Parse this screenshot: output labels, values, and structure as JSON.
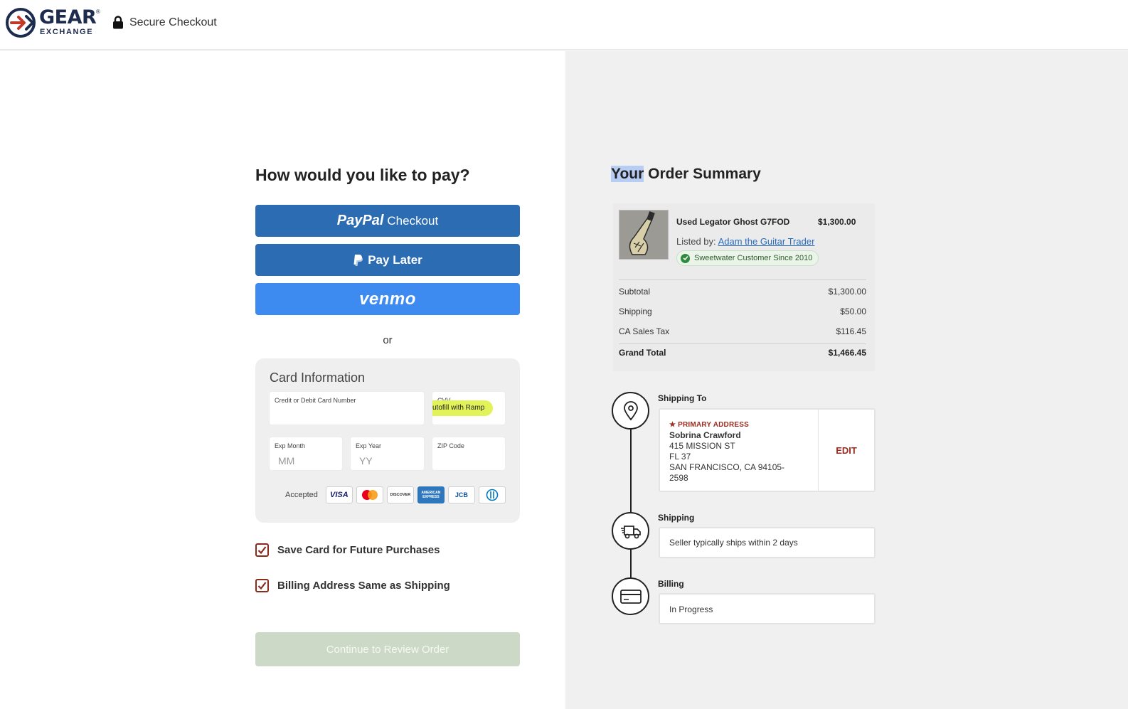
{
  "header": {
    "logo_main": "GEAR",
    "logo_reg": "®",
    "logo_sub": "EXCHANGE",
    "secure_label": "Secure Checkout"
  },
  "payment": {
    "title": "How would you like to pay?",
    "paypal_brand": "PayPal",
    "paypal_label": "Checkout",
    "paylater_label": "Pay Later",
    "venmo_label": "venmo",
    "or_label": "or",
    "card": {
      "title": "Card Information",
      "card_number_label": "Credit or Debit Card Number",
      "cvv_label": "CVV",
      "autofill_label": "utofill with Ramp",
      "exp_month_label": "Exp Month",
      "exp_month_placeholder": "MM",
      "exp_year_label": "Exp Year",
      "exp_year_placeholder": "YY",
      "zip_label": "ZIP Code",
      "accepted_label": "Accepted",
      "card_brands": [
        {
          "name": "VISA",
          "icon": "visa-icon",
          "color": "#1a1f71"
        },
        {
          "name": "",
          "icon": "mastercard-icon",
          "color": "#eb001b"
        },
        {
          "name": "DISCOVER",
          "icon": "discover-icon",
          "color": "#f58220"
        },
        {
          "name": "AMERICAN EXPRESS",
          "icon": "amex-icon",
          "color": "#2e77bc"
        },
        {
          "name": "JCB",
          "icon": "jcb-icon",
          "color": "#0b4ea2"
        },
        {
          "name": "",
          "icon": "diners-icon",
          "color": "#0079be"
        }
      ]
    },
    "save_card_label": "Save Card for Future Purchases",
    "save_card_checked": true,
    "billing_same_label": "Billing Address Same as Shipping",
    "billing_same_checked": true,
    "continue_label": "Continue to Review Order"
  },
  "summary": {
    "title_highlighted": "Your",
    "title_rest": " Order Summary",
    "item": {
      "name": "Used Legator Ghost G7FOD",
      "price": "$1,300.00",
      "listed_by_label": "Listed by:",
      "seller": "Adam the Guitar Trader",
      "badge": "Sweetwater Customer Since 2010"
    },
    "rows": [
      {
        "label": "Subtotal",
        "value": "$1,300.00"
      },
      {
        "label": "Shipping",
        "value": "$50.00"
      },
      {
        "label": "CA Sales Tax",
        "value": "$116.45"
      }
    ],
    "total": {
      "label": "Grand Total",
      "value": "$1,466.45"
    }
  },
  "timeline": {
    "shipping_to": {
      "label": "Shipping To",
      "primary_label": "★ PRIMARY ADDRESS",
      "name": "Sobrina Crawford",
      "line1": "415 MISSION ST",
      "line2": "FL 37",
      "line3": "SAN FRANCISCO, CA 94105-",
      "line4": "2598",
      "edit_label": "EDIT"
    },
    "shipping": {
      "label": "Shipping",
      "text": "Seller typically ships within 2 days"
    },
    "billing": {
      "label": "Billing",
      "text": "In Progress"
    }
  },
  "colors": {
    "paypal_blue": "#2b6cb3",
    "venmo_blue": "#3d8bf0",
    "accent_red": "#9b2b1e",
    "continue_disabled": "#cbd9c6",
    "panel_gray": "#f0f0f1"
  }
}
